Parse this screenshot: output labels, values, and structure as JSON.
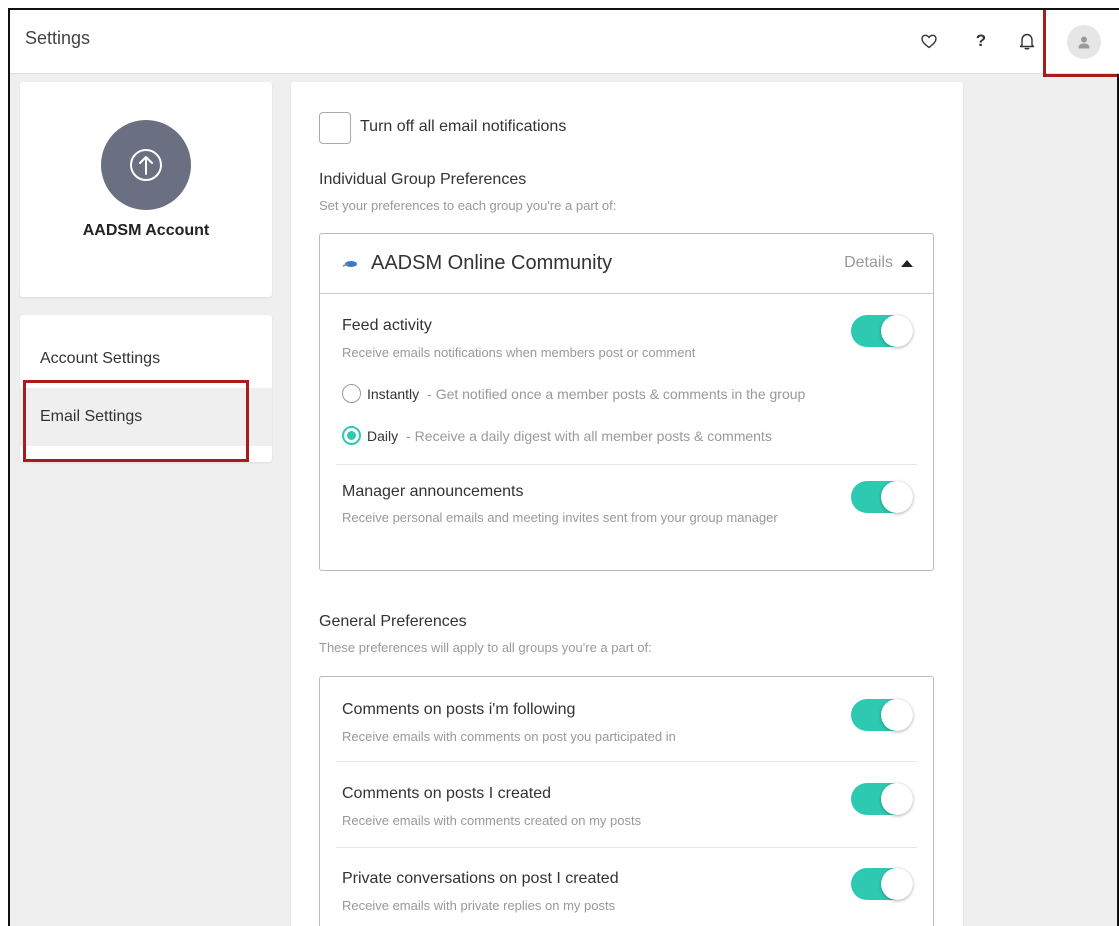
{
  "header": {
    "title": "Settings",
    "help_label": "?"
  },
  "icons": {
    "heart": "heart-icon",
    "help": "help-icon",
    "bell": "bell-icon",
    "avatar": "user-icon",
    "upload": "upload-icon"
  },
  "profile": {
    "account_name": "AADSM Account"
  },
  "sidebar": {
    "items": [
      {
        "label": "Account Settings"
      },
      {
        "label": "Email Settings"
      }
    ]
  },
  "main": {
    "turn_off_all": "Turn off all email notifications",
    "individual": {
      "title": "Individual Group Preferences",
      "subtitle": "Set your preferences to each group you're a part of:",
      "group_name": "AADSM Online Community",
      "details_label": "Details",
      "feed": {
        "title": "Feed activity",
        "subtitle": "Receive emails notifications when members post or comment",
        "enabled": true,
        "options": [
          {
            "label": "Instantly",
            "desc": "- Get notified once a member posts & comments in the group",
            "selected": false
          },
          {
            "label": "Daily",
            "desc": "- Receive a daily digest with all member posts & comments",
            "selected": true
          }
        ]
      },
      "announcements": {
        "title": "Manager announcements",
        "subtitle": "Receive personal emails and meeting invites sent from your group manager",
        "enabled": true
      }
    },
    "general": {
      "title": "General Preferences",
      "subtitle": "These preferences will apply to all groups you're a part of:",
      "items": [
        {
          "title": "Comments on posts i'm following",
          "subtitle": "Receive emails with comments on post you participated in",
          "enabled": true
        },
        {
          "title": "Comments on posts I created",
          "subtitle": "Receive emails with comments created on my posts",
          "enabled": true
        },
        {
          "title": "Private conversations on post I created",
          "subtitle": "Receive emails with private replies on my posts",
          "enabled": true
        }
      ]
    }
  },
  "colors": {
    "accent": "#2ec9b1",
    "highlight": "#a81c1c",
    "avatar_bg": "#6b6f82"
  }
}
